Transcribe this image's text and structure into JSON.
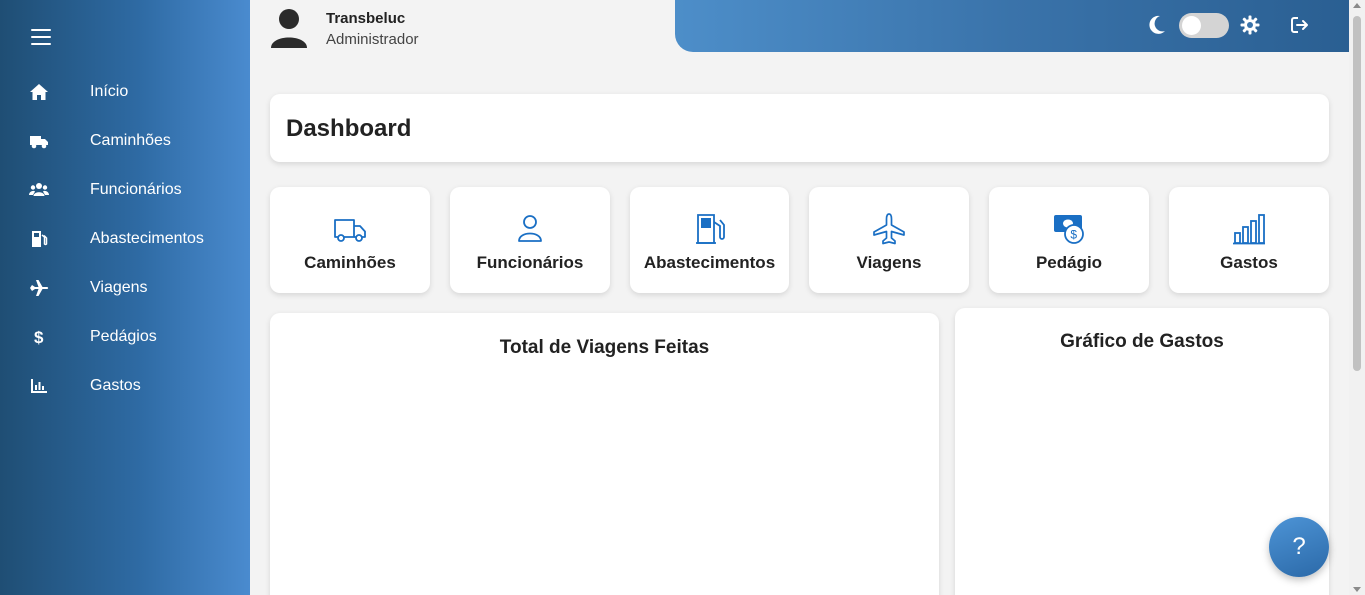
{
  "sidebar": {
    "items": [
      {
        "label": "Início",
        "icon": "home-icon"
      },
      {
        "label": "Caminhões",
        "icon": "truck-icon"
      },
      {
        "label": "Funcionários",
        "icon": "users-icon"
      },
      {
        "label": "Abastecimentos",
        "icon": "gas-pump-icon"
      },
      {
        "label": "Viagens",
        "icon": "plane-icon"
      },
      {
        "label": "Pedágios",
        "icon": "dollar-icon"
      },
      {
        "label": "Gastos",
        "icon": "bar-chart-icon"
      }
    ]
  },
  "header": {
    "user_name": "Transbeluc",
    "user_role": "Administrador",
    "theme_toggle_on": false
  },
  "main": {
    "title": "Dashboard",
    "quick_links": [
      {
        "label": "Caminhões",
        "icon": "truck-icon"
      },
      {
        "label": "Funcionários",
        "icon": "person-icon"
      },
      {
        "label": "Abastecimentos",
        "icon": "fuel-station-icon"
      },
      {
        "label": "Viagens",
        "icon": "airplane-icon"
      },
      {
        "label": "Pedágio",
        "icon": "money-icon"
      },
      {
        "label": "Gastos",
        "icon": "bar-chart-icon"
      }
    ],
    "panels": {
      "trips_title": "Total de Viagens Feitas",
      "expenses_title": "Gráfico de Gastos"
    },
    "help_label": "?"
  },
  "colors": {
    "accent": "#1a6fc4",
    "sidebar_start": "#1f4e74",
    "sidebar_end": "#4a8bcf"
  }
}
